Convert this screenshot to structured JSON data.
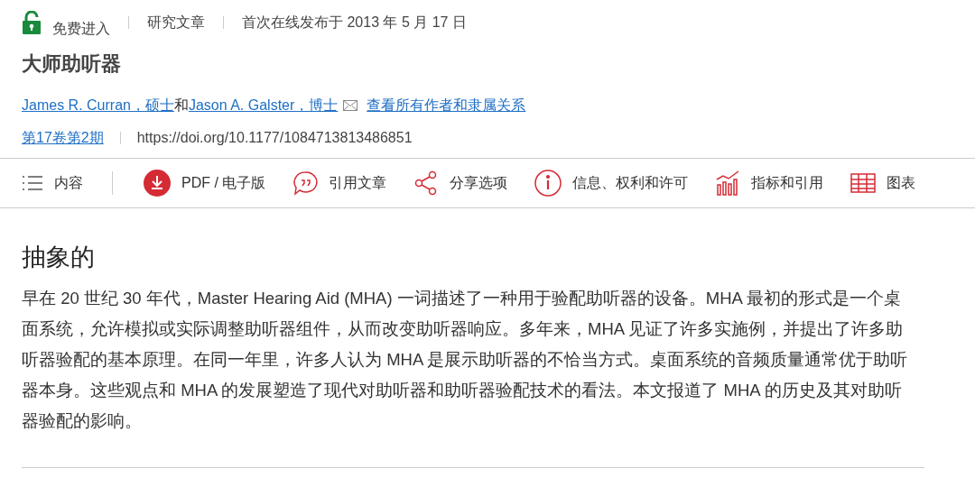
{
  "meta": {
    "access": "免费进入",
    "type": "研究文章",
    "published": "首次在线发布于 2013 年 5 月 17 日"
  },
  "title": "大师助听器",
  "authors": [
    {
      "name": "James R. Curran，硕士"
    },
    {
      "name": "Jason A. Galster，博士"
    }
  ],
  "author_join": "和",
  "affiliations_link": "查看所有作者和隶属关系",
  "issue": "第17卷第2期",
  "doi": "https://doi.org/10.1177/1084713813486851",
  "toolbar": [
    {
      "label": "内容"
    },
    {
      "label": "PDF / 电子版"
    },
    {
      "label": "引用文章"
    },
    {
      "label": "分享选项"
    },
    {
      "label": "信息、权利和许可"
    },
    {
      "label": "指标和引用"
    },
    {
      "label": "图表"
    }
  ],
  "abstract": {
    "heading": "抽象的",
    "text": "早在 20 世纪 30 年代，Master Hearing Aid (MHA) 一词描述了一种用于验配助听器的设备。MHA 最初的形式是一个桌面系统，允许模拟或实际调整助听器组件，从而改变助听器响应。多年来，MHA 见证了许多实施例，并提出了许多助听器验配的基本原理。在同一年里，许多人认为 MHA 是展示助听器的不恰当方式。桌面系统的音频质量通常优于助听器本身。这些观点和 MHA 的发展塑造了现代对助听器和助听器验配技术的看法。本文报道了 MHA 的历史及其对助听器验配的影响。"
  }
}
